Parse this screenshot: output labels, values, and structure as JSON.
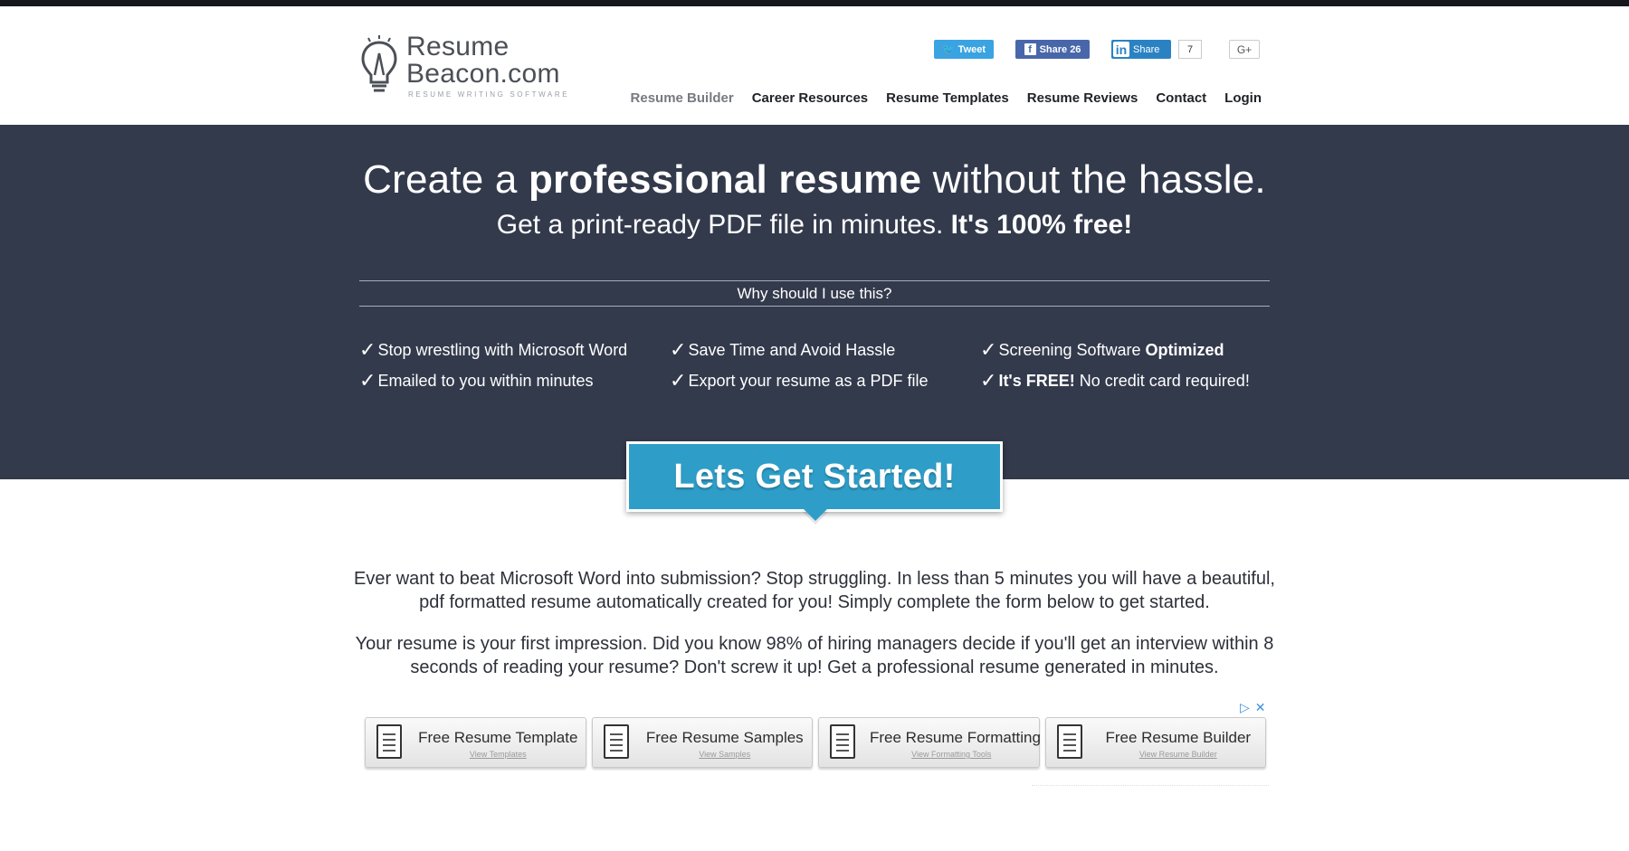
{
  "brand": {
    "line1": "Resume",
    "line2": "Beacon.com",
    "tagline": "RESUME WRITING SOFTWARE"
  },
  "social": {
    "tweet_label": "Tweet",
    "fb_label": "Share 26",
    "linkedin_label": "Share",
    "linkedin_count": "7",
    "gplus_label": "G+"
  },
  "nav": {
    "items": [
      {
        "label": "Resume Builder"
      },
      {
        "label": "Career Resources"
      },
      {
        "label": "Resume Templates"
      },
      {
        "label": "Resume Reviews"
      },
      {
        "label": "Contact"
      },
      {
        "label": "Login"
      }
    ]
  },
  "hero": {
    "headline_pre": "Create a ",
    "headline_bold": "professional resume",
    "headline_post": " without the hassle.",
    "sub_pre": "Get a print-ready PDF file in minutes. ",
    "sub_bold": "It's 100% free!",
    "why_title": "Why should I use this?"
  },
  "features": [
    {
      "text": "Stop wrestling with Microsoft Word",
      "bold": ""
    },
    {
      "text": "Emailed to you within minutes",
      "bold": ""
    },
    {
      "text": "Save Time and Avoid Hassle",
      "bold": ""
    },
    {
      "text": "Export your resume as a PDF file",
      "bold": ""
    },
    {
      "text": "Screening Software ",
      "bold": "Optimized"
    },
    {
      "bold_first": "It's FREE!",
      "text": " No credit card required!"
    }
  ],
  "cta": {
    "label": "Lets Get Started!"
  },
  "paragraphs": [
    "Ever want to beat Microsoft Word into submission? Stop struggling. In less than 5 minutes you will have a beautiful, pdf formatted resume automatically created for you! Simply complete the form below to get started.",
    "Your resume is your first impression. Did you know 98% of hiring managers decide if you'll get an interview within 8 seconds of reading your resume? Don't screw it up! Get a professional resume generated in minutes."
  ],
  "ads": {
    "choices_icon": "▷",
    "close_icon": "✕",
    "items": [
      {
        "title": "Free Resume Template",
        "sub": "View Templates"
      },
      {
        "title": "Free Resume Samples",
        "sub": "View Samples"
      },
      {
        "title": "Free Resume Formatting",
        "sub": "View Formatting Tools"
      },
      {
        "title": "Free Resume Builder",
        "sub": "View Resume Builder"
      }
    ]
  },
  "colors": {
    "hero_bg": "#333a4c",
    "cta_bg": "#2e9ec8",
    "twitter": "#3aa3e1",
    "facebook": "#4867aa",
    "linkedin": "#2b82c3"
  }
}
